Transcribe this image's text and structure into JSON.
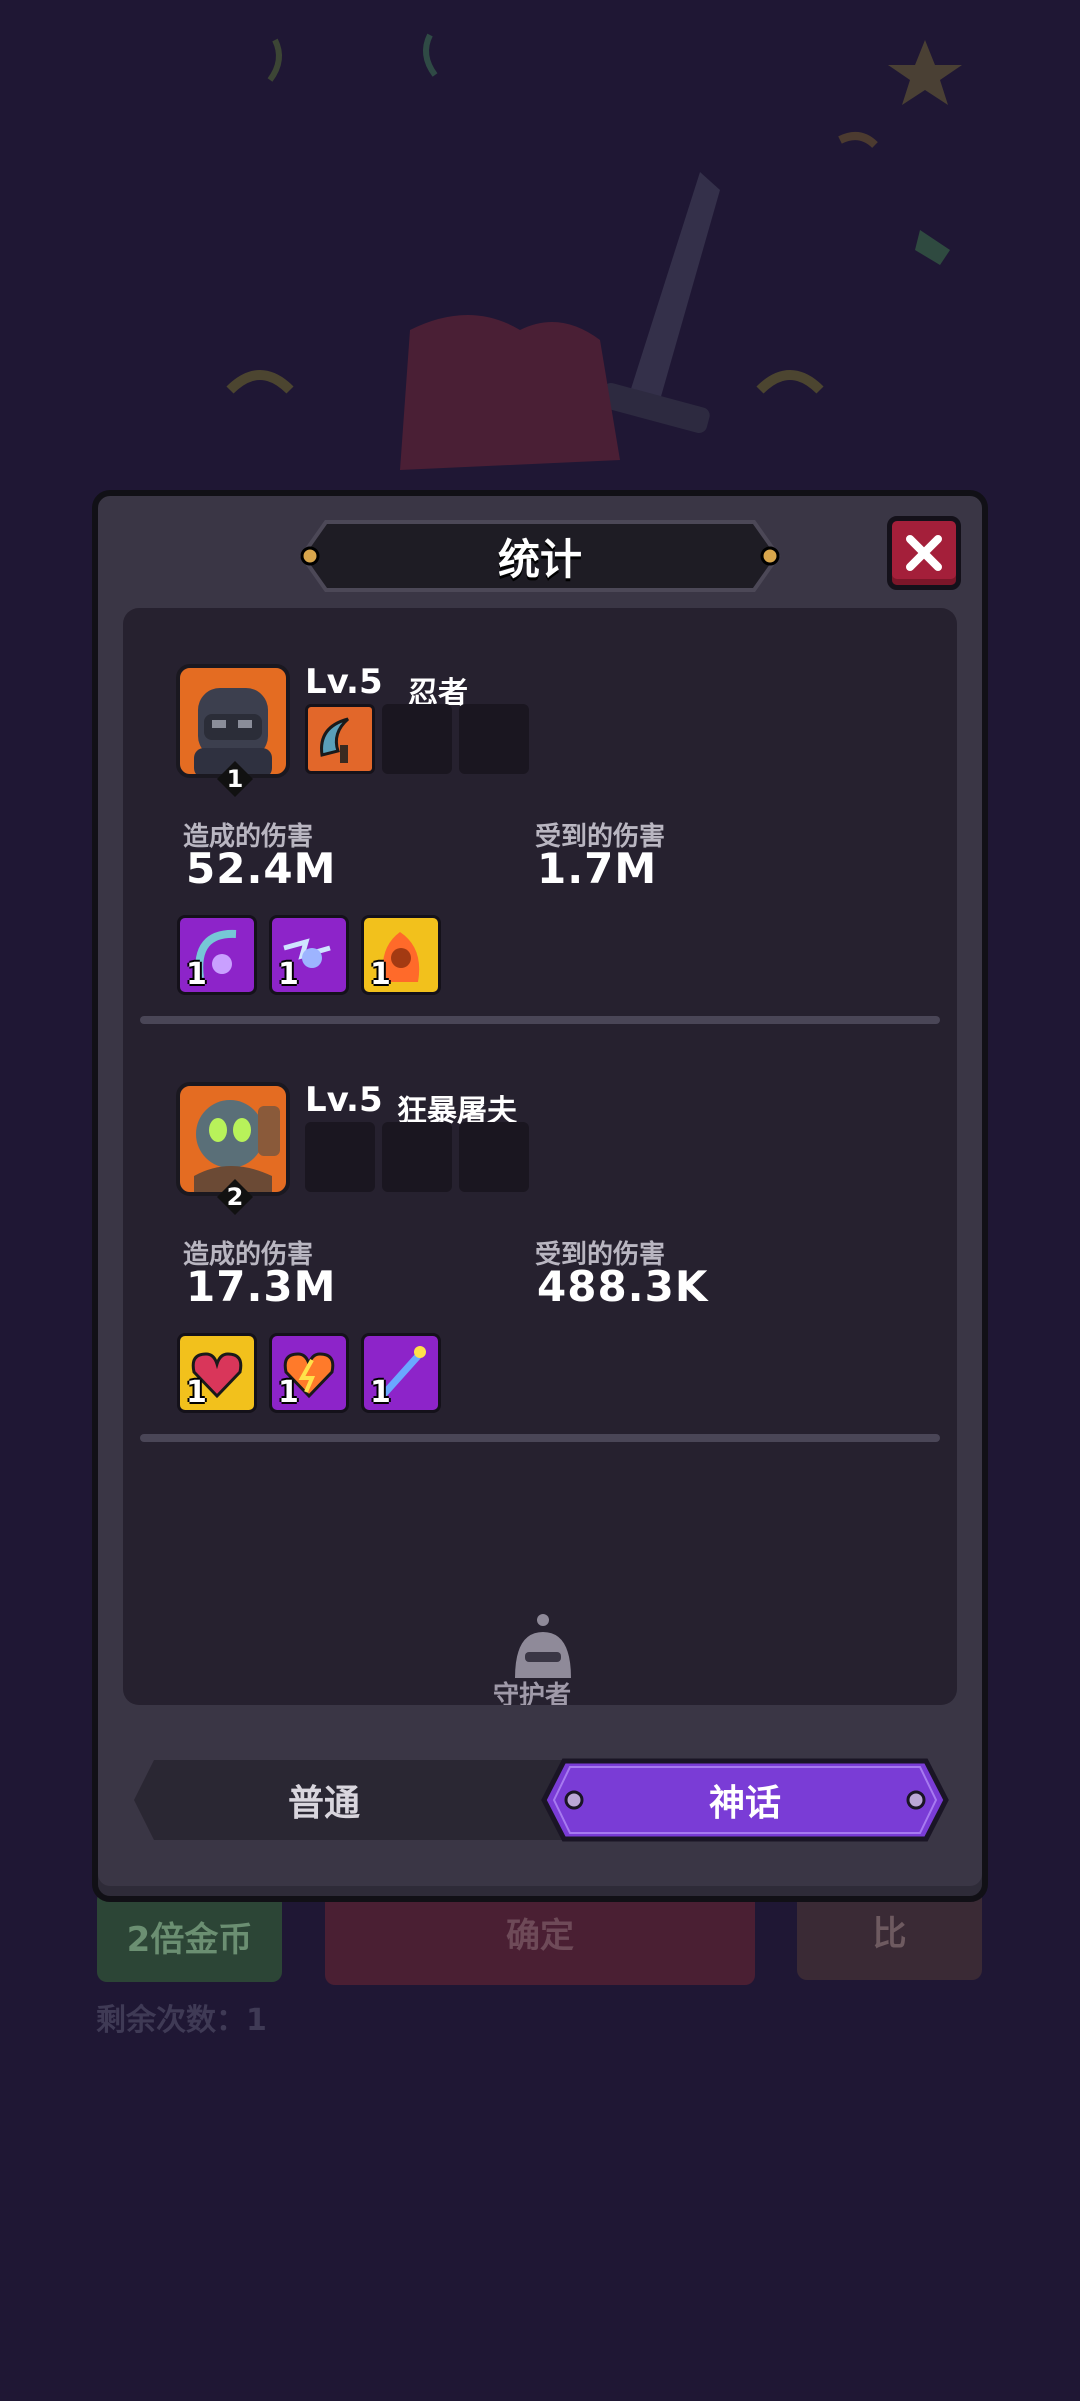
{
  "background": {
    "buttons": {
      "double_coins": "2倍金币",
      "confirm": "确定",
      "other": "比"
    },
    "remaining_text": "剩余次数：1"
  },
  "dialog": {
    "title": "统计",
    "heroes": [
      {
        "rank": "1",
        "level": "Lv.5",
        "name": "忍者",
        "damage_dealt_label": "造成的伤害",
        "damage_dealt": "52.4M",
        "damage_taken_label": "受到的伤害",
        "damage_taken": "1.7M",
        "skills": [
          {
            "icon": "scythe-skill-icon",
            "count": "1",
            "rarity_color": "#8d24c9"
          },
          {
            "icon": "lightning-skill-icon",
            "count": "1",
            "rarity_color": "#8d24c9"
          },
          {
            "icon": "fire-spirit-skill-icon",
            "count": "1",
            "rarity_color": "#f2c11c"
          }
        ]
      },
      {
        "rank": "2",
        "level": "Lv.5",
        "name": "狂暴屠夫",
        "damage_dealt_label": "造成的伤害",
        "damage_dealt": "17.3M",
        "damage_taken_label": "受到的伤害",
        "damage_taken": "488.3K",
        "skills": [
          {
            "icon": "heart-skill-icon",
            "count": "1",
            "rarity_color": "#f2c11c"
          },
          {
            "icon": "energy-heart-skill-icon",
            "count": "1",
            "rarity_color": "#8d24c9"
          },
          {
            "icon": "magic-wand-skill-icon",
            "count": "1",
            "rarity_color": "#8d24c9"
          }
        ]
      }
    ],
    "peek_text": "守护者",
    "tabs": {
      "normal": "普通",
      "myth": "神话",
      "active": "myth"
    }
  },
  "colors": {
    "accent_purple": "#7a3cd6",
    "close_red": "#a41f3a"
  }
}
